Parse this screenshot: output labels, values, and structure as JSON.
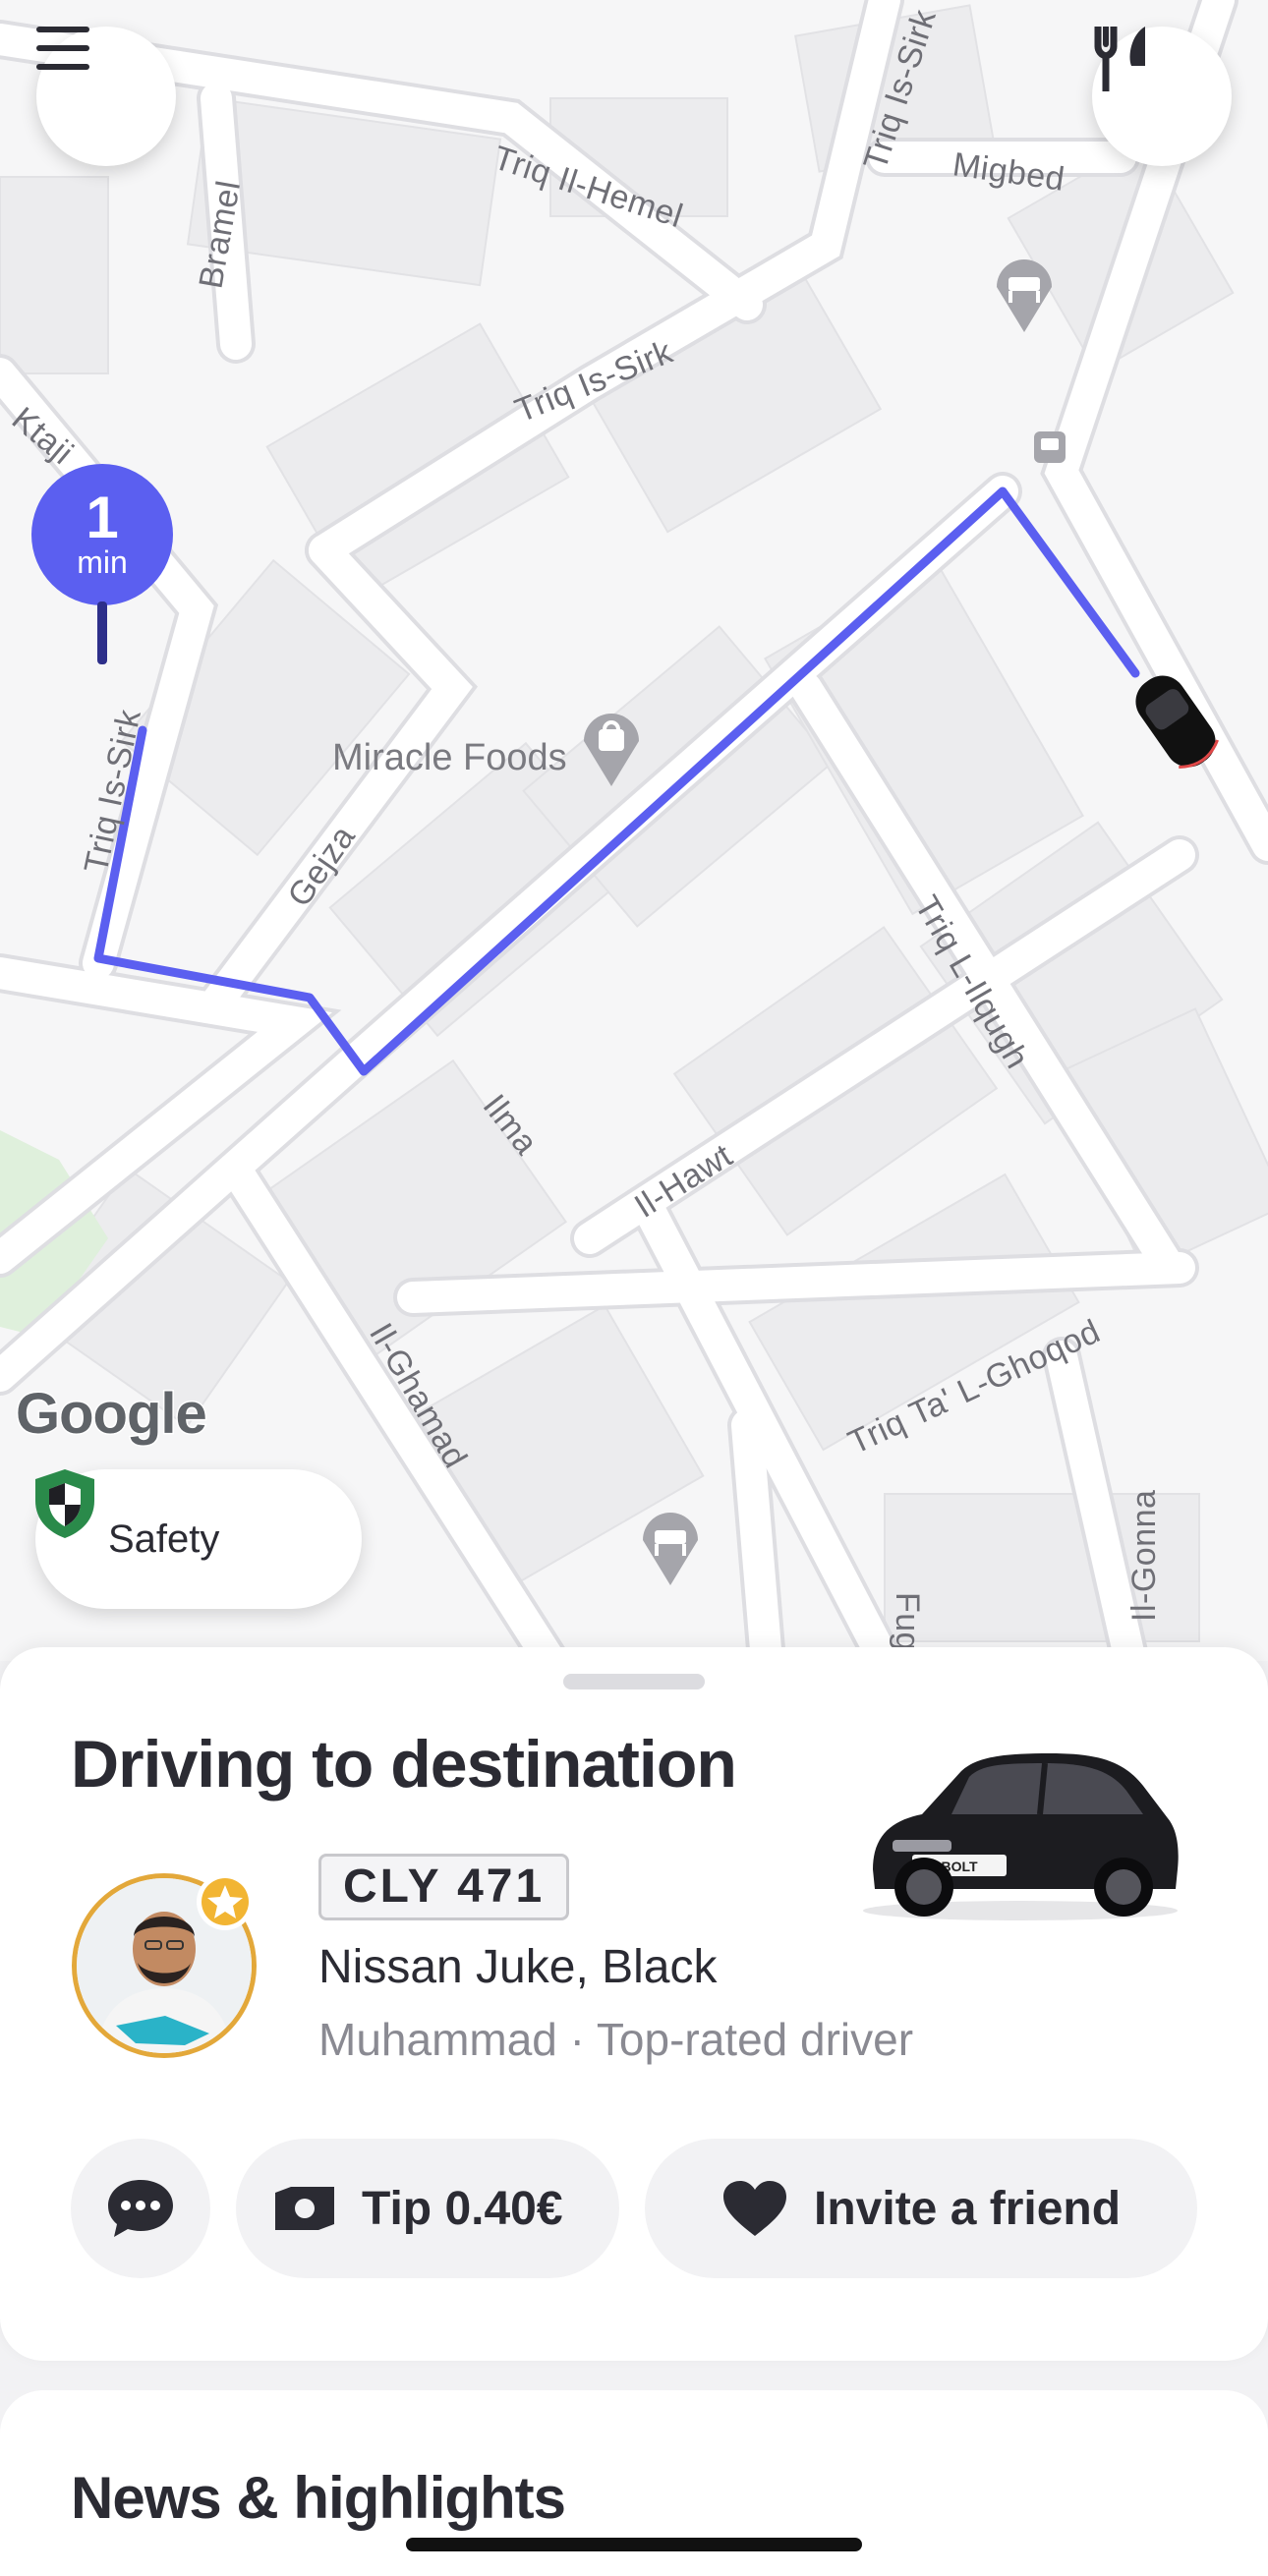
{
  "map": {
    "streets": [
      "Triq Il-Hemel",
      "Triq Is-Sirk",
      "Migbed",
      "Bramel",
      "Triq Is-Sirk",
      "Ktaji",
      "Triq Is-Sirk",
      "Gejza",
      "Ilma",
      "Il-Hawt",
      "Triq L-Ilqugh",
      "Il-Ghamad",
      "Triq Ta' L-Ghoqod",
      "Il-Gonna",
      "Fug"
    ],
    "poi_name": "Miracle Foods",
    "eta": {
      "value": "1",
      "unit": "min"
    },
    "google_logo": "Google",
    "route_color": "#5b5ff0"
  },
  "top_bar": {
    "menu_icon": "hamburger-menu-icon",
    "food_icon": "fork-knife-icon"
  },
  "safety": {
    "label": "Safety",
    "icon": "shield-icon"
  },
  "trip": {
    "status_title": "Driving to destination",
    "plate": "CLY 471",
    "car_model": "Nissan Juke, Black",
    "driver_line": "Muhammad · Top-rated driver",
    "car_badge": "BOLT"
  },
  "actions": {
    "chat_icon": "chat-bubble-icon",
    "tip_label": "Tip 0.40€",
    "tip_icon": "cash-icon",
    "invite_label": "Invite a friend",
    "invite_icon": "heart-icon"
  },
  "news": {
    "title": "News & highlights"
  },
  "colors": {
    "accent": "#5b5ff0",
    "text": "#2b2b33",
    "muted": "#8a8a92"
  }
}
